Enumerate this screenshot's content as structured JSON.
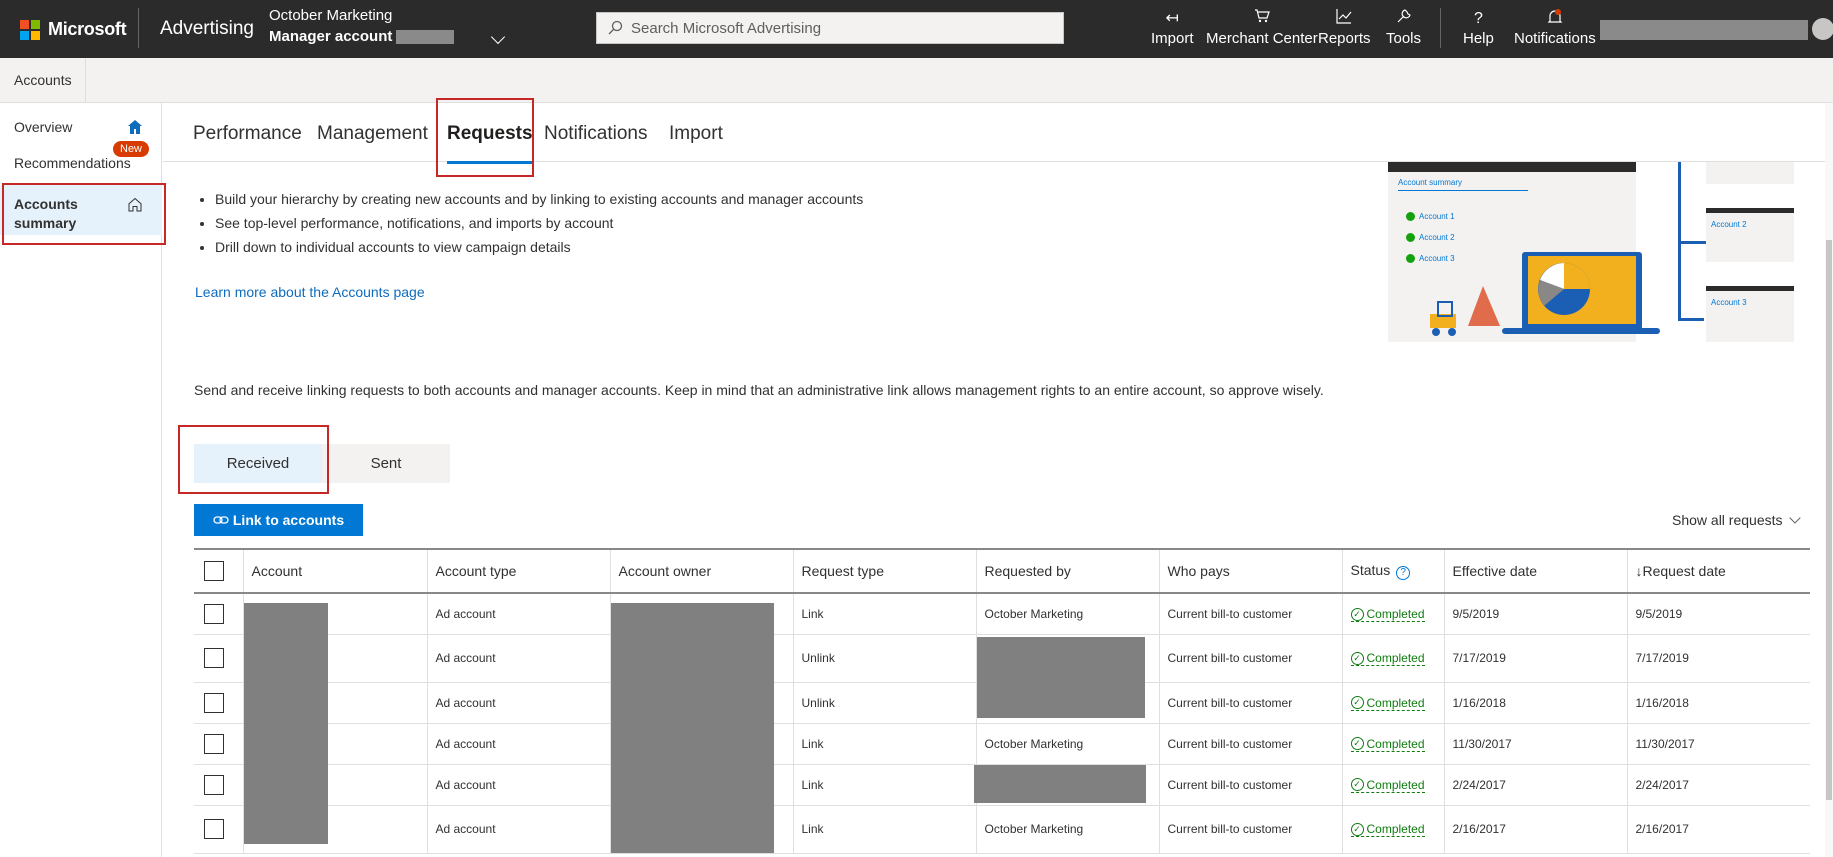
{
  "topbar": {
    "brand": "Microsoft",
    "product": "Advertising",
    "account_name": "October Marketing",
    "account_label": "Manager account",
    "search_placeholder": "Search Microsoft Advertising",
    "items": [
      {
        "label": "Import",
        "icon": "import-icon"
      },
      {
        "label": "Merchant Center",
        "icon": "cart-icon"
      },
      {
        "label": "Reports",
        "icon": "chart-icon"
      },
      {
        "label": "Tools",
        "icon": "wrench-icon"
      },
      {
        "label": "Help",
        "icon": "question-icon"
      },
      {
        "label": "Notifications",
        "icon": "bell-icon"
      }
    ],
    "logo_colors": [
      "#f25022",
      "#7fba00",
      "#00a4ef",
      "#ffb900"
    ]
  },
  "breadcrumb": "Accounts",
  "sidebar": {
    "items": [
      {
        "label": "Overview"
      },
      {
        "label": "Recommendations",
        "badge": "New"
      },
      {
        "label": "Accounts summary"
      }
    ]
  },
  "tabs": [
    "Performance",
    "Management",
    "Requests",
    "Notifications",
    "Import"
  ],
  "bullets": [
    "Build your hierarchy by creating new accounts and by linking to existing accounts and manager accounts",
    "See top-level performance, notifications, and imports by account",
    "Drill down to individual accounts to view campaign details"
  ],
  "learn_more": "Learn more about the Accounts page",
  "info_text": "Send and receive linking requests to both accounts and manager accounts. Keep in mind that an administrative link allows management rights to an entire account, so approve wisely.",
  "illustration": {
    "title": "Account summary",
    "accounts": [
      "Account 1",
      "Account 2",
      "Account 3"
    ],
    "side_cards": [
      "Account 2",
      "Account 3"
    ]
  },
  "segments": [
    "Received",
    "Sent"
  ],
  "link_button": "Link to accounts",
  "show_all": "Show all requests",
  "table": {
    "headers": [
      "Account",
      "Account type",
      "Account owner",
      "Request type",
      "Requested by",
      "Who pays",
      "Status",
      "Effective date",
      "Request date"
    ],
    "rows": [
      {
        "type": "Ad account",
        "request": "Link",
        "requested_by": "October Marketing",
        "who_pays": "Current bill-to customer",
        "status": "Completed",
        "effective": "9/5/2019",
        "request_date": "9/5/2019"
      },
      {
        "type": "Ad account",
        "request": "Unlink",
        "requested_by": "",
        "who_pays": "Current bill-to customer",
        "status": "Completed",
        "effective": "7/17/2019",
        "request_date": "7/17/2019"
      },
      {
        "type": "Ad account",
        "request": "Unlink",
        "requested_by": "",
        "who_pays": "Current bill-to customer",
        "status": "Completed",
        "effective": "1/16/2018",
        "request_date": "1/16/2018"
      },
      {
        "type": "Ad account",
        "request": "Link",
        "requested_by": "October Marketing",
        "who_pays": "Current bill-to customer",
        "status": "Completed",
        "effective": "11/30/2017",
        "request_date": "11/30/2017"
      },
      {
        "type": "Ad account",
        "request": "Link",
        "requested_by": "",
        "who_pays": "Current bill-to customer",
        "status": "Completed",
        "effective": "2/24/2017",
        "request_date": "2/24/2017"
      },
      {
        "type": "Ad account",
        "request": "Link",
        "requested_by": "October Marketing",
        "who_pays": "Current bill-to customer",
        "status": "Completed",
        "effective": "2/16/2017",
        "request_date": "2/16/2017"
      }
    ]
  },
  "colors": {
    "accent": "#0078d4",
    "success": "#107c10",
    "highlight": "#c62828"
  }
}
